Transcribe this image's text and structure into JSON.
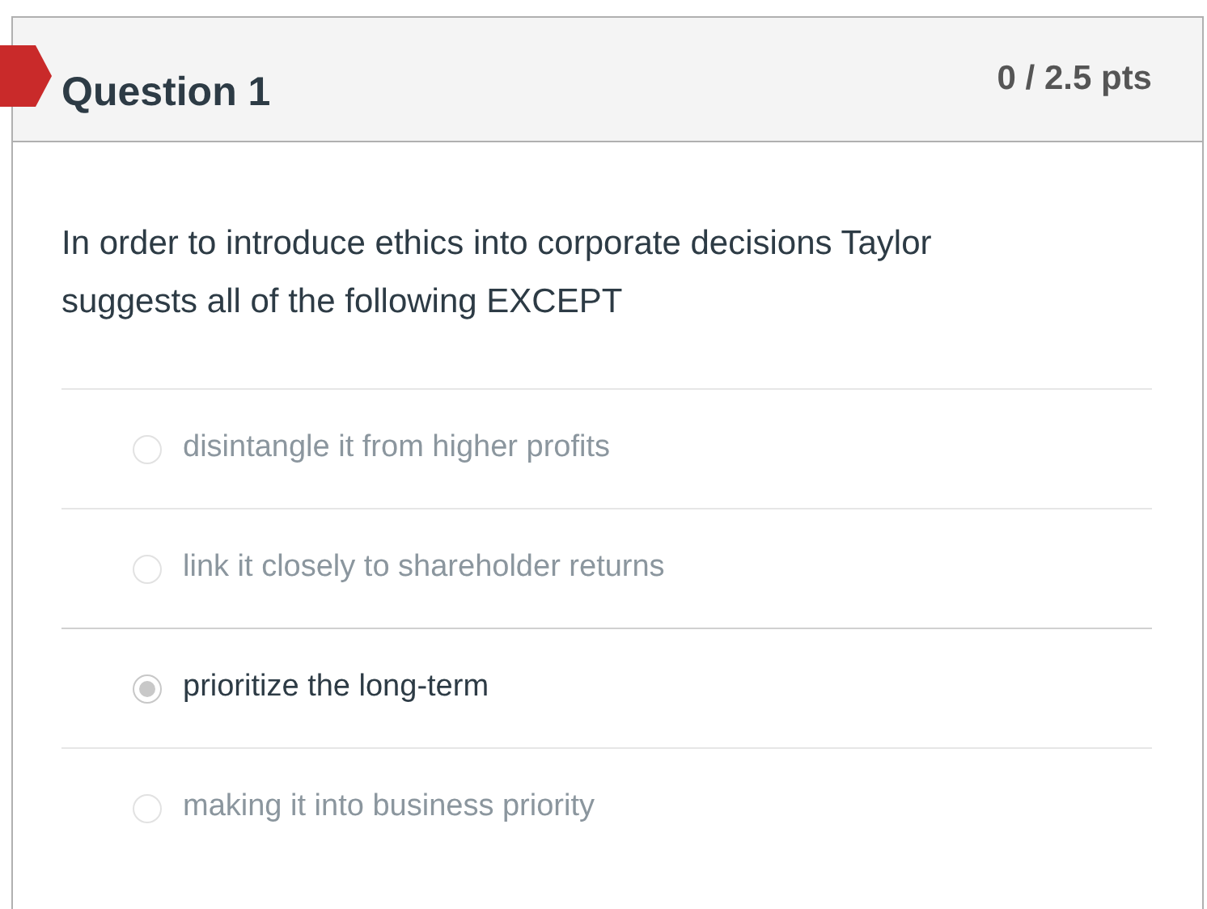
{
  "question": {
    "title": "Question 1",
    "score": "0 / 2.5 pts",
    "incorrect": true,
    "text": "In order to introduce ethics into corporate decisions Taylor suggests all of the following EXCEPT",
    "answers": [
      {
        "label": "disintangle it from higher profits",
        "selected": false
      },
      {
        "label": "link it closely to shareholder returns",
        "selected": false
      },
      {
        "label": "prioritize the long-term",
        "selected": true
      },
      {
        "label": "making it into business priority",
        "selected": false
      }
    ]
  }
}
